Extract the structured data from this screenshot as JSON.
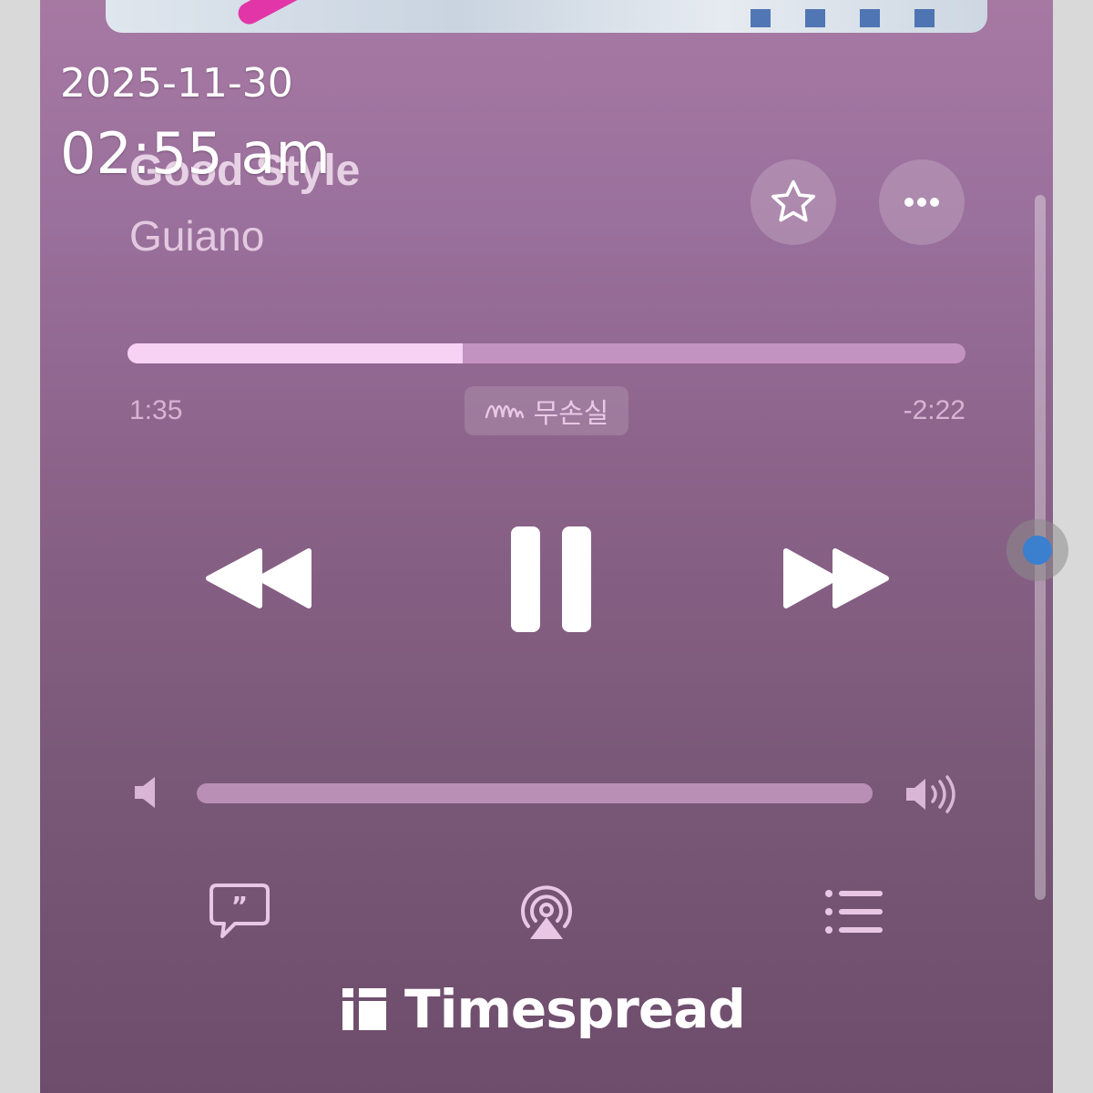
{
  "overlay": {
    "date": "2025-11-30",
    "time": "02:55 am"
  },
  "track": {
    "title": "Good Style",
    "artist": "Guiano"
  },
  "playback": {
    "elapsed": "1:35",
    "remaining": "-2:22",
    "progress": 0.4,
    "quality_badge": "무손실"
  },
  "volume": {
    "level": 0.0
  },
  "controls": [
    "rewind-icon",
    "pause-icon",
    "forward-icon",
    "star-icon",
    "more-icon",
    "lyrics-icon",
    "airplay-icon",
    "queue-icon"
  ],
  "watermark": {
    "text": "Timespread"
  },
  "colors": {
    "accent_progress": "#f7d2f5",
    "touch_indicator": "#3b7fcf"
  }
}
